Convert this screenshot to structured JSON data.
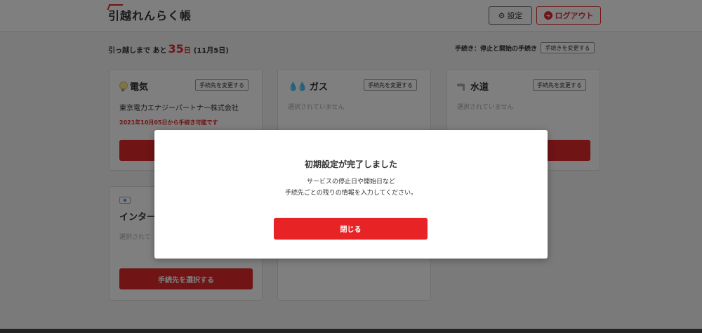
{
  "header": {
    "logo": "引越れんらく帳",
    "settings_label": "設定",
    "logout_label": "ログアウト"
  },
  "countdown": {
    "prefix": "引っ越しまで あと",
    "days": "35",
    "unit": "日",
    "date": "(11月5日)"
  },
  "procedure": {
    "label": "手続き：停止と開始の手続き",
    "change_label": "手続きを変更する"
  },
  "cards": [
    {
      "title": "電気",
      "change_label": "手続先を変更する",
      "company": "東京電力エナジーパートナー株式会社",
      "note": "2021年10月05日から手続き可能です",
      "icon": "bulb-icon"
    },
    {
      "title": "ガス",
      "change_label": "手続先を変更する",
      "empty": "選択されていません",
      "icon": "gas-icon"
    },
    {
      "title": "水道",
      "change_label": "手続先を変更する",
      "empty": "選択されていません",
      "icon": "tap-icon"
    },
    {
      "title": "インター",
      "empty": "選択されて",
      "button_label": "手続先を選択する",
      "icon": "router-icon"
    }
  ],
  "modal": {
    "title": "初期設定が完了しました",
    "line1": "サービスの停止日や開始日など",
    "line2": "手続先ごとの残りの情報を入力してください。",
    "close_label": "閉じる"
  },
  "colors": {
    "accent": "#e0282c",
    "overlay": "rgba(0,0,0,0.5)"
  }
}
